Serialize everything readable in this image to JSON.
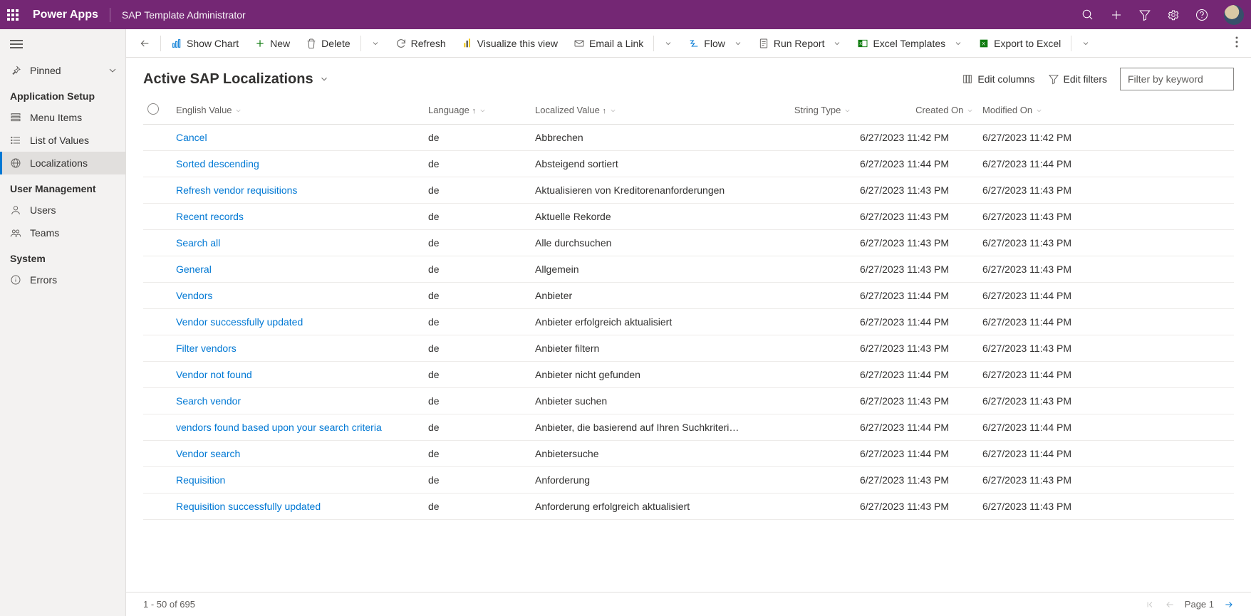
{
  "topbar": {
    "brand": "Power Apps",
    "app_title": "SAP Template Administrator"
  },
  "sidebar": {
    "pinned_label": "Pinned",
    "groups": [
      {
        "header": "Application Setup",
        "items": [
          {
            "icon": "list",
            "label": "Menu Items",
            "active": false
          },
          {
            "icon": "listval",
            "label": "List of Values",
            "active": false
          },
          {
            "icon": "globe",
            "label": "Localizations",
            "active": true
          }
        ]
      },
      {
        "header": "User Management",
        "items": [
          {
            "icon": "user",
            "label": "Users",
            "active": false
          },
          {
            "icon": "team",
            "label": "Teams",
            "active": false
          }
        ]
      },
      {
        "header": "System",
        "items": [
          {
            "icon": "info",
            "label": "Errors",
            "active": false
          }
        ]
      }
    ]
  },
  "commands": {
    "show_chart": "Show Chart",
    "new": "New",
    "delete": "Delete",
    "refresh": "Refresh",
    "visualize": "Visualize this view",
    "email": "Email a Link",
    "flow": "Flow",
    "run_report": "Run Report",
    "excel_templates": "Excel Templates",
    "export_excel": "Export to Excel"
  },
  "view": {
    "title": "Active SAP Localizations",
    "edit_columns": "Edit columns",
    "edit_filters": "Edit filters",
    "filter_placeholder": "Filter by keyword"
  },
  "columns": {
    "english": "English Value",
    "language": "Language",
    "localized": "Localized Value",
    "string_type": "String Type",
    "created": "Created On",
    "modified": "Modified On"
  },
  "rows": [
    {
      "english": "Cancel",
      "lang": "de",
      "localized": "Abbrechen",
      "created": "6/27/2023 11:42 PM",
      "modified": "6/27/2023 11:42 PM"
    },
    {
      "english": "Sorted descending",
      "lang": "de",
      "localized": "Absteigend sortiert",
      "created": "6/27/2023 11:44 PM",
      "modified": "6/27/2023 11:44 PM"
    },
    {
      "english": "Refresh vendor requisitions",
      "lang": "de",
      "localized": "Aktualisieren von Kreditorenanforderungen",
      "created": "6/27/2023 11:43 PM",
      "modified": "6/27/2023 11:43 PM"
    },
    {
      "english": "Recent records",
      "lang": "de",
      "localized": "Aktuelle Rekorde",
      "created": "6/27/2023 11:43 PM",
      "modified": "6/27/2023 11:43 PM"
    },
    {
      "english": "Search all",
      "lang": "de",
      "localized": "Alle durchsuchen",
      "created": "6/27/2023 11:43 PM",
      "modified": "6/27/2023 11:43 PM"
    },
    {
      "english": "General",
      "lang": "de",
      "localized": "Allgemein",
      "created": "6/27/2023 11:43 PM",
      "modified": "6/27/2023 11:43 PM"
    },
    {
      "english": "Vendors",
      "lang": "de",
      "localized": "Anbieter",
      "created": "6/27/2023 11:44 PM",
      "modified": "6/27/2023 11:44 PM"
    },
    {
      "english": "Vendor successfully updated",
      "lang": "de",
      "localized": "Anbieter erfolgreich aktualisiert",
      "created": "6/27/2023 11:44 PM",
      "modified": "6/27/2023 11:44 PM"
    },
    {
      "english": "Filter vendors",
      "lang": "de",
      "localized": "Anbieter filtern",
      "created": "6/27/2023 11:43 PM",
      "modified": "6/27/2023 11:43 PM"
    },
    {
      "english": "Vendor not found",
      "lang": "de",
      "localized": "Anbieter nicht gefunden",
      "created": "6/27/2023 11:44 PM",
      "modified": "6/27/2023 11:44 PM"
    },
    {
      "english": "Search vendor",
      "lang": "de",
      "localized": "Anbieter suchen",
      "created": "6/27/2023 11:43 PM",
      "modified": "6/27/2023 11:43 PM"
    },
    {
      "english": "vendors found based upon your search criteria",
      "lang": "de",
      "localized": "Anbieter, die basierend auf Ihren Suchkriterien g...",
      "created": "6/27/2023 11:44 PM",
      "modified": "6/27/2023 11:44 PM"
    },
    {
      "english": "Vendor search",
      "lang": "de",
      "localized": "Anbietersuche",
      "created": "6/27/2023 11:44 PM",
      "modified": "6/27/2023 11:44 PM"
    },
    {
      "english": "Requisition",
      "lang": "de",
      "localized": "Anforderung",
      "created": "6/27/2023 11:43 PM",
      "modified": "6/27/2023 11:43 PM"
    },
    {
      "english": "Requisition successfully updated",
      "lang": "de",
      "localized": "Anforderung erfolgreich aktualisiert",
      "created": "6/27/2023 11:43 PM",
      "modified": "6/27/2023 11:43 PM"
    }
  ],
  "footer": {
    "range": "1 - 50 of 695",
    "page_label": "Page 1"
  }
}
